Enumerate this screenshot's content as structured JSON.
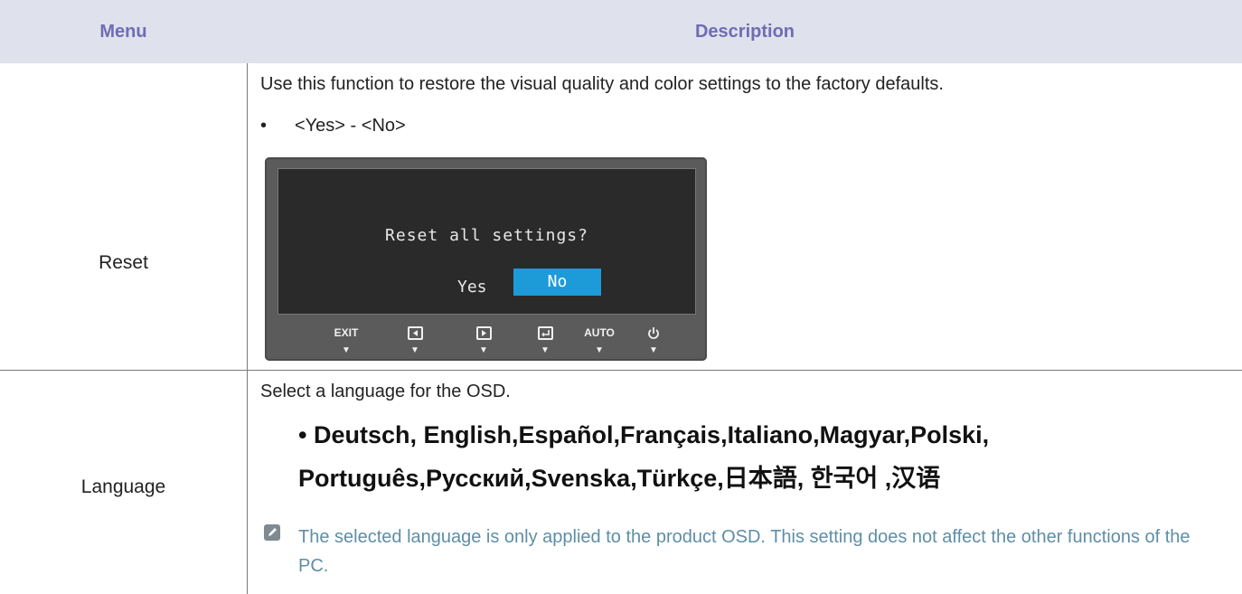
{
  "header": {
    "menu": "Menu",
    "description": "Description"
  },
  "rows": {
    "reset": {
      "menu": "Reset",
      "description": "Use this function to restore the visual quality and color settings to the factory defaults.",
      "bullet_marker": "•",
      "bullet": "<Yes> - <No>",
      "osd": {
        "question": "Reset all settings?",
        "yes": "Yes",
        "no": "No",
        "selected": "No",
        "buttons": [
          "EXIT",
          "left-icon",
          "right-icon",
          "enter-icon",
          "AUTO",
          "power-icon"
        ],
        "exit_label": "EXIT",
        "auto_label": "AUTO",
        "arrow": "▼",
        "highlight_color": "#1d9bd9"
      }
    },
    "language": {
      "menu": "Language",
      "description": "Select a language for the OSD.",
      "languages_line1": "• Deutsch, English,Español,Français,Italiano,Magyar,Polski,",
      "languages_line2": "Português,Русский,Svenska,Türkçe,日本語, 한국어 ,汉语",
      "note": "The selected language is only applied to the product OSD. This setting does not affect the other functions of the PC."
    }
  },
  "colors": {
    "header_bg": "#dfe1ec",
    "header_text": "#6f6cb4",
    "note_text": "#5f8ea6"
  }
}
